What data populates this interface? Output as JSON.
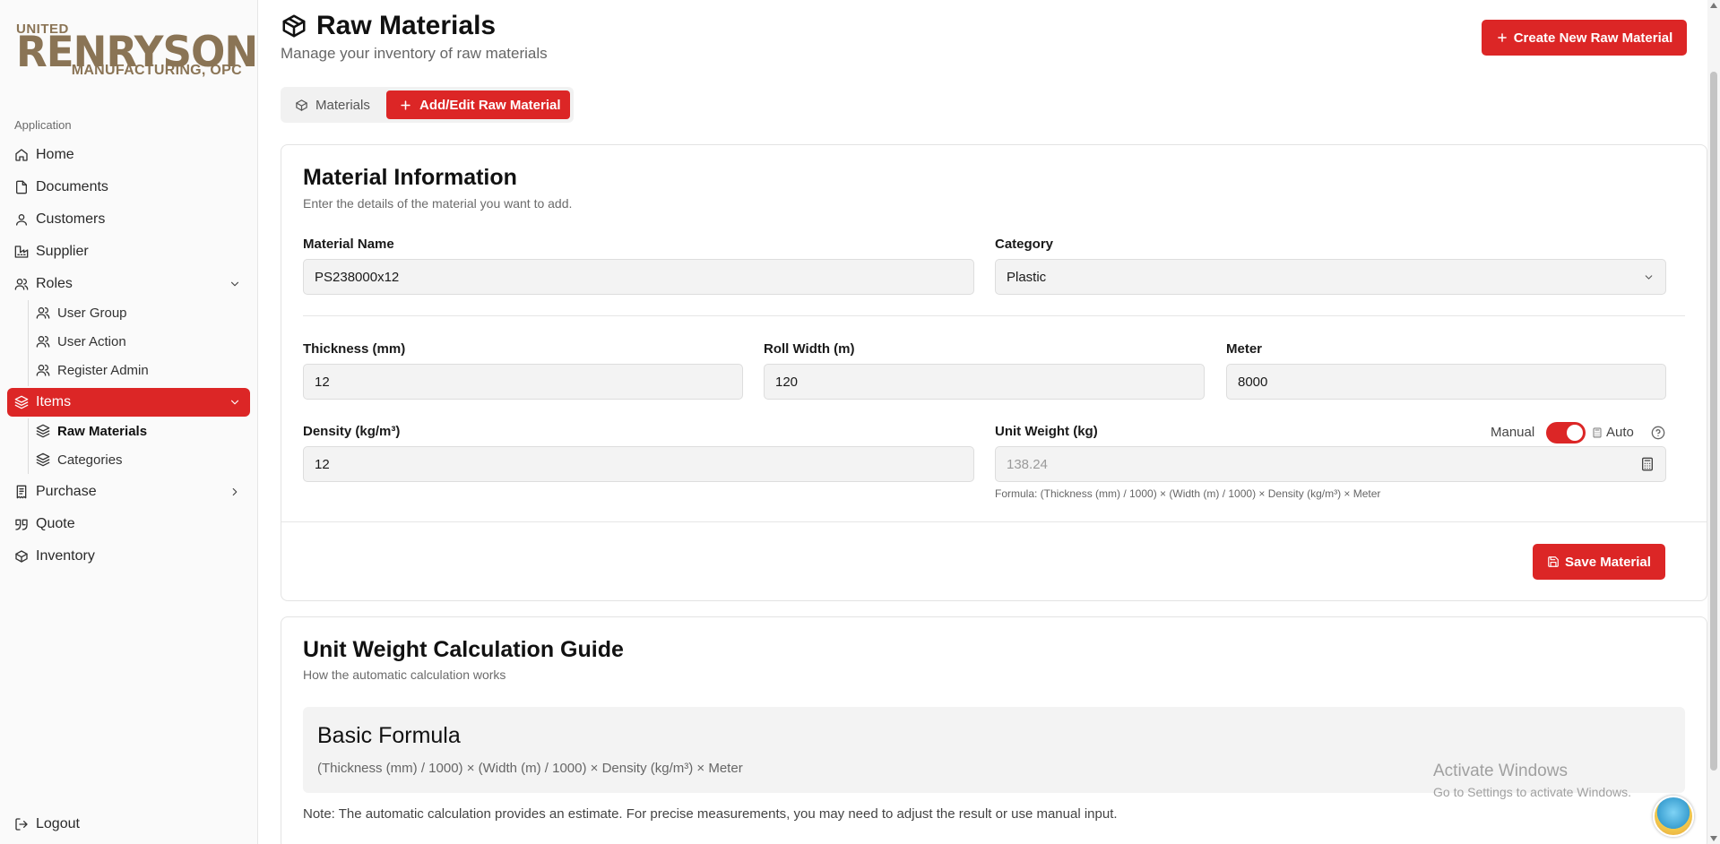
{
  "brand": {
    "line1": "UNITED",
    "line2": "RENRYSON",
    "line3": "MANUFACTURING, OPC"
  },
  "sidebar": {
    "section": "Application",
    "items": [
      {
        "label": "Home",
        "icon": "home-icon"
      },
      {
        "label": "Documents",
        "icon": "file-icon"
      },
      {
        "label": "Customers",
        "icon": "user-icon"
      },
      {
        "label": "Supplier",
        "icon": "factory-icon"
      },
      {
        "label": "Roles",
        "icon": "users-icon"
      },
      {
        "label": "Items",
        "icon": "layers-icon"
      },
      {
        "label": "Purchase",
        "icon": "receipt-icon"
      },
      {
        "label": "Quote",
        "icon": "quote-icon"
      },
      {
        "label": "Inventory",
        "icon": "box-icon"
      }
    ],
    "roles_sub": [
      {
        "label": "User Group"
      },
      {
        "label": "User Action"
      },
      {
        "label": "Register Admin"
      }
    ],
    "items_sub": [
      {
        "label": "Raw Materials"
      },
      {
        "label": "Categories"
      }
    ],
    "logout": "Logout"
  },
  "header": {
    "title": "Raw Materials",
    "subtitle": "Manage your inventory of raw materials",
    "create_button": "Create New Raw Material"
  },
  "tabs": [
    {
      "label": "Materials",
      "active": false
    },
    {
      "label": "Add/Edit Raw Material",
      "active": true
    }
  ],
  "form": {
    "title": "Material Information",
    "description": "Enter the details of the material you want to add.",
    "material_name": {
      "label": "Material Name",
      "value": "PS238000x12"
    },
    "category": {
      "label": "Category",
      "value": "Plastic"
    },
    "thickness": {
      "label": "Thickness (mm)",
      "value": "12"
    },
    "roll_width": {
      "label": "Roll Width (m)",
      "value": "120"
    },
    "meter": {
      "label": "Meter",
      "value": "8000"
    },
    "density": {
      "label": "Density (kg/m³)",
      "value": "12"
    },
    "unit_weight": {
      "label": "Unit Weight (kg)",
      "value": "138.24",
      "mode_manual": "Manual",
      "mode_auto": "Auto",
      "toggle_on": true,
      "formula": "Formula: (Thickness (mm) / 1000) × (Width (m) / 1000) × Density (kg/m³) × Meter"
    },
    "save_button": "Save Material"
  },
  "guide": {
    "title": "Unit Weight Calculation Guide",
    "description": "How the automatic calculation works",
    "box_title": "Basic Formula",
    "formula": "(Thickness (mm) / 1000) × (Width (m) / 1000) × Density (kg/m³) × Meter",
    "note": "Note: The automatic calculation provides an estimate. For precise measurements, you may need to adjust the result or use manual input."
  },
  "watermark": {
    "line1": "Activate Windows",
    "line2": "Go to Settings to activate Windows."
  },
  "colors": {
    "accent": "#dc2626",
    "brand": "#8a7455"
  }
}
